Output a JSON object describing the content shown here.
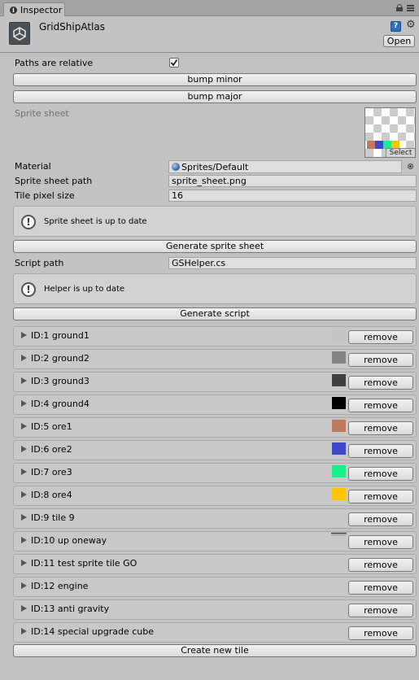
{
  "tab": {
    "title": "Inspector"
  },
  "header": {
    "title": "GridShipAtlas",
    "open_label": "Open"
  },
  "paths_relative": {
    "label": "Paths are relative",
    "checked": true
  },
  "buttons": {
    "bump_minor": "bump minor",
    "bump_major": "bump major",
    "generate_sheet": "Generate sprite sheet",
    "generate_script": "Generate script",
    "create_tile": "Create new tile"
  },
  "sprite_sheet": {
    "label": "Sprite sheet",
    "select_label": "Select"
  },
  "fields": {
    "material_label": "Material",
    "material_value": "Sprites/Default",
    "sheet_path_label": "Sprite sheet path",
    "sheet_path_value": "sprite_sheet.png",
    "tile_size_label": "Tile pixel size",
    "tile_size_value": "16",
    "script_path_label": "Script path",
    "script_path_value": "GSHelper.cs"
  },
  "messages": {
    "sheet_status": "Sprite sheet is up to date",
    "helper_status": "Helper is up to date"
  },
  "remove_label": "remove",
  "tiles": [
    {
      "label": "ID:1 ground1",
      "color": "#c4c4c4"
    },
    {
      "label": "ID:2 ground2",
      "color": "#858585"
    },
    {
      "label": "ID:3 ground3",
      "color": "#404040"
    },
    {
      "label": "ID:4 ground4",
      "color": "#000000"
    },
    {
      "label": "ID:5 ore1",
      "color": "#bd7a5c"
    },
    {
      "label": "ID:6 ore2",
      "color": "#3f49c7"
    },
    {
      "label": "ID:7 ore3",
      "color": "#17f08a"
    },
    {
      "label": "ID:8 ore4",
      "color": "#ffc300"
    },
    {
      "label": "ID:9 tile 9",
      "color": ""
    },
    {
      "label": "ID:10 up oneway",
      "color": "line"
    },
    {
      "label": "ID:11 test sprite tile GO",
      "color": ""
    },
    {
      "label": "ID:12 engine",
      "color": ""
    },
    {
      "label": "ID:13 anti gravity",
      "color": ""
    },
    {
      "label": "ID:14 special upgrade cube",
      "color": ""
    }
  ]
}
